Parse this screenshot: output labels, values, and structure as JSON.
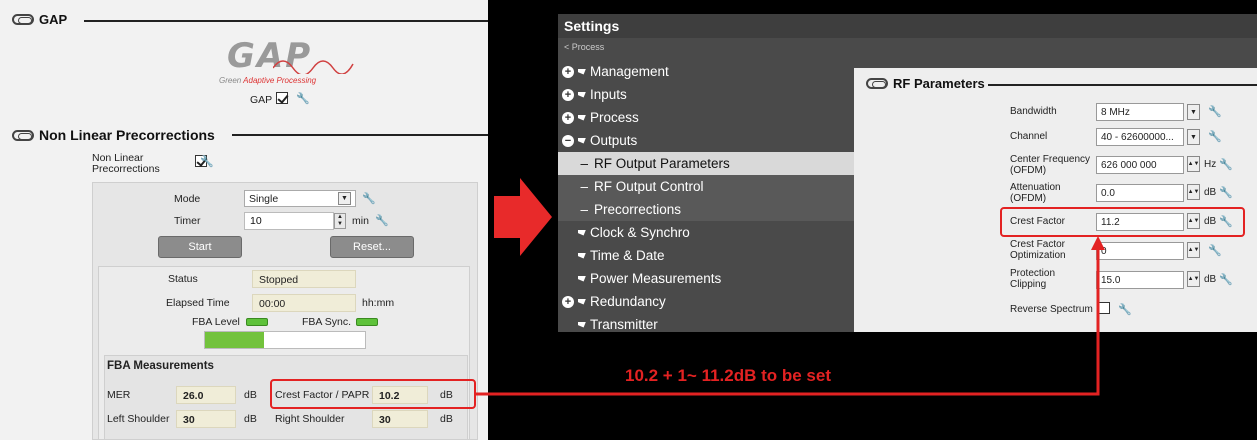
{
  "left": {
    "gap_section": {
      "title": "GAP"
    },
    "logo": {
      "big": "GAP",
      "sub_green": "Green",
      "sub_adaptive": "Adaptive",
      "sub_processing": "Processing"
    },
    "gap_checkbox_label": "GAP",
    "nlp_section": {
      "title": "Non Linear Precorrections"
    },
    "nlp_label": "Non Linear\nPrecorrections",
    "mode": {
      "label": "Mode",
      "value": "Single"
    },
    "timer": {
      "label": "Timer",
      "value": "10",
      "unit": "min"
    },
    "start_label": "Start",
    "reset_label": "Reset...",
    "status": {
      "label": "Status",
      "value": "Stopped"
    },
    "elapsed": {
      "label": "Elapsed Time",
      "value": "00:00",
      "unit": "hh:mm"
    },
    "fba_level_label": "FBA Level",
    "fba_sync_label": "FBA Sync.",
    "progress": 0.37,
    "fba_title": "FBA Measurements",
    "mer": {
      "label": "MER",
      "value": "26.0",
      "unit": "dB"
    },
    "crest_papr": {
      "label": "Crest Factor / PAPR",
      "value": "10.2",
      "unit": "dB"
    },
    "left_shoulder": {
      "label": "Left Shoulder",
      "value": "30",
      "unit": "dB"
    },
    "right_shoulder": {
      "label": "Right Shoulder",
      "value": "30",
      "unit": "dB"
    }
  },
  "settings": {
    "title": "Settings",
    "back": "< Process",
    "tree": [
      {
        "label": "Management",
        "kind": "plus"
      },
      {
        "label": "Inputs",
        "kind": "plus"
      },
      {
        "label": "Process",
        "kind": "plus"
      },
      {
        "label": "Outputs",
        "kind": "minus"
      },
      {
        "label": "RF Output Parameters",
        "kind": "sub-selected"
      },
      {
        "label": "RF Output Control",
        "kind": "sub"
      },
      {
        "label": "Precorrections",
        "kind": "sub"
      },
      {
        "label": "Clock & Synchro",
        "kind": "leaf"
      },
      {
        "label": "Time & Date",
        "kind": "leaf"
      },
      {
        "label": "Power Measurements",
        "kind": "leaf"
      },
      {
        "label": "Redundancy",
        "kind": "plus"
      },
      {
        "label": "Transmitter",
        "kind": "leaf"
      }
    ],
    "rf_title": "RF Parameters",
    "bandwidth": {
      "label": "Bandwidth",
      "value": "8 MHz"
    },
    "channel": {
      "label": "Channel",
      "value": "40 - 62600000..."
    },
    "center_freq": {
      "label": "Center Frequency\n(OFDM)",
      "value": "626 000 000",
      "unit": "Hz"
    },
    "attenuation": {
      "label": "Attenuation\n(OFDM)",
      "value": "0.0",
      "unit": "dB"
    },
    "crest": {
      "label": "Crest Factor",
      "value": "11.2",
      "unit": "dB"
    },
    "crest_opt": {
      "label": "Crest Factor\nOptimization",
      "value": "0"
    },
    "protection": {
      "label": "Protection\nClipping",
      "value": "15.0",
      "unit": "dB"
    },
    "reverse": {
      "label": "Reverse Spectrum"
    }
  },
  "annotation": "10.2 + 1~ 11.2dB to be set",
  "colors": {
    "accent_red": "#e32222",
    "led_green": "#5ec23a"
  }
}
